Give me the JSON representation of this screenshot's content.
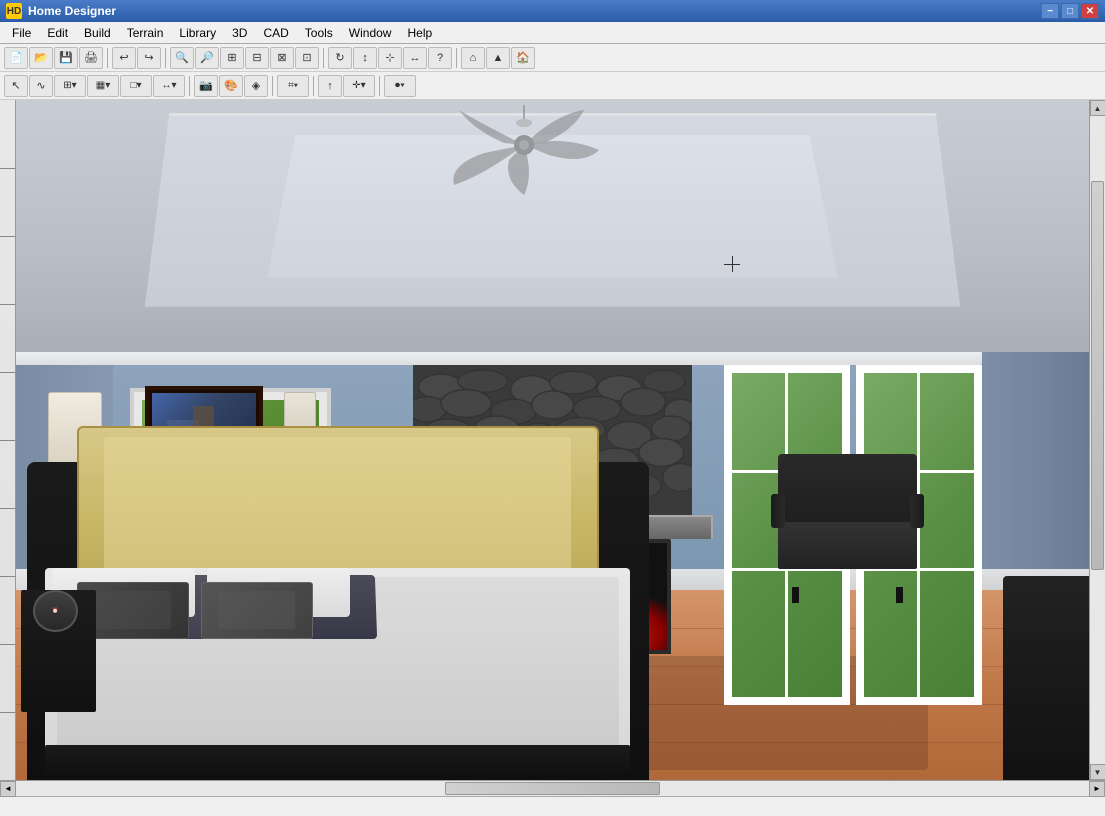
{
  "app": {
    "title": "Home Designer",
    "icon": "HD"
  },
  "title_bar": {
    "title": "Home Designer",
    "minimize_label": "−",
    "maximize_label": "□",
    "close_label": "✕"
  },
  "menu": {
    "items": [
      "File",
      "Edit",
      "Build",
      "Terrain",
      "Library",
      "3D",
      "CAD",
      "Tools",
      "Window",
      "Help"
    ]
  },
  "toolbar1": {
    "buttons": [
      {
        "id": "new",
        "icon": "📄"
      },
      {
        "id": "open",
        "icon": "📁"
      },
      {
        "id": "save",
        "icon": "💾"
      },
      {
        "id": "print",
        "icon": "🖨"
      },
      {
        "id": "undo",
        "icon": "↩"
      },
      {
        "id": "redo",
        "icon": "↪"
      },
      {
        "id": "zoom-in",
        "icon": "🔍"
      },
      {
        "id": "zoom-out",
        "icon": "🔎"
      },
      {
        "id": "zoom-fit",
        "icon": "⊞"
      },
      {
        "id": "zoom-window",
        "icon": "⊟"
      },
      {
        "id": "zoom-real",
        "icon": "⊠"
      },
      {
        "id": "pan",
        "icon": "✋"
      },
      {
        "id": "3d-view",
        "icon": "▣"
      },
      {
        "id": "question",
        "icon": "?"
      },
      {
        "id": "toolbar-sep1",
        "type": "sep"
      },
      {
        "id": "plan",
        "icon": "⌂"
      },
      {
        "id": "elevation",
        "icon": "▲"
      },
      {
        "id": "home2",
        "icon": "🏠"
      }
    ]
  },
  "toolbar2": {
    "buttons": [
      {
        "id": "select",
        "icon": "↖"
      },
      {
        "id": "polyline",
        "icon": "∿"
      },
      {
        "id": "wall",
        "icon": "⊞"
      },
      {
        "id": "cabinet",
        "icon": "▦"
      },
      {
        "id": "room",
        "icon": "□"
      },
      {
        "id": "dimension",
        "icon": "↔"
      },
      {
        "id": "camera",
        "icon": "📷"
      },
      {
        "id": "sep1",
        "type": "sep"
      },
      {
        "id": "color",
        "icon": "🎨"
      },
      {
        "id": "material",
        "icon": "◈"
      },
      {
        "id": "texture",
        "icon": "◉"
      },
      {
        "id": "stair",
        "icon": "⌗"
      },
      {
        "id": "sep2",
        "type": "sep"
      },
      {
        "id": "arrow-up",
        "icon": "↑"
      },
      {
        "id": "move",
        "icon": "✛"
      },
      {
        "id": "record",
        "icon": "⏺"
      }
    ]
  },
  "status_bar": {
    "text": ""
  },
  "scrollbar": {
    "up": "▲",
    "down": "▼",
    "left": "◄",
    "right": "►"
  }
}
